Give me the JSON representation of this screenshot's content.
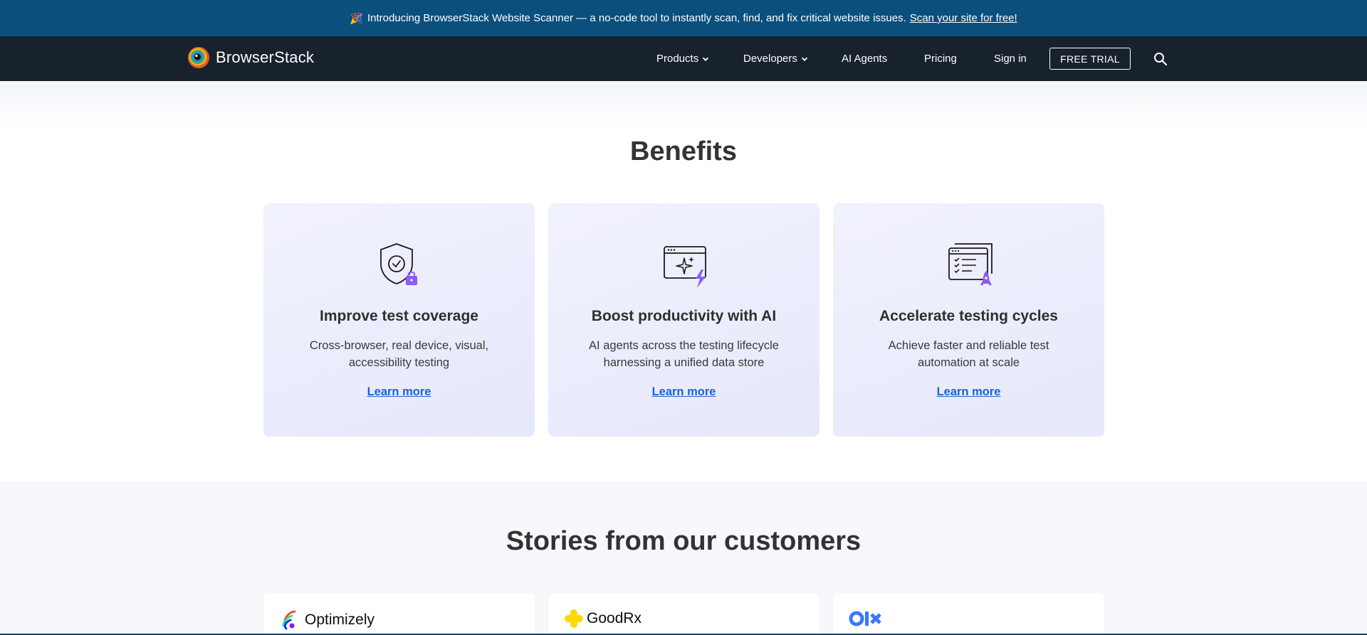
{
  "announcement": {
    "emoji": "🎉",
    "text": "Introducing BrowserStack Website Scanner — a no-code tool to instantly scan, find, and fix critical website issues.",
    "link": "Scan your site for free!"
  },
  "nav": {
    "brand": "BrowserStack",
    "items": [
      {
        "label": "Products",
        "dropdown": true
      },
      {
        "label": "Developers",
        "dropdown": true
      },
      {
        "label": "AI Agents",
        "dropdown": false
      },
      {
        "label": "Pricing",
        "dropdown": false
      },
      {
        "label": "Sign in",
        "dropdown": false
      }
    ],
    "cta": "FREE TRIAL",
    "search_icon": "search-icon"
  },
  "benefits": {
    "title": "Benefits",
    "cards": [
      {
        "icon": "shield-check-lock-icon",
        "title": "Improve test coverage",
        "desc": "Cross-browser, real device, visual, accessibility testing",
        "link": "Learn more"
      },
      {
        "icon": "browser-sparkle-bolt-icon",
        "title": "Boost productivity with AI",
        "desc": "AI agents across the testing lifecycle harnessing a unified data store",
        "link": "Learn more"
      },
      {
        "icon": "checklist-rocket-icon",
        "title": "Accelerate testing cycles",
        "desc": "Achieve faster and reliable test automation at scale",
        "link": "Learn more"
      }
    ]
  },
  "stories": {
    "title": "Stories from our customers",
    "customers": [
      {
        "name": "Optimizely",
        "logo": "optimizely-logo"
      },
      {
        "name": "GoodRx",
        "logo": "goodrx-logo"
      },
      {
        "name": "",
        "logo": "olx-logo"
      }
    ]
  },
  "colors": {
    "announcement_bg": "#0b4f7c",
    "nav_bg": "#17222c",
    "link": "#1b62d4",
    "accent_purple": "#8b5cf6",
    "card_bg": "#eceefc"
  }
}
